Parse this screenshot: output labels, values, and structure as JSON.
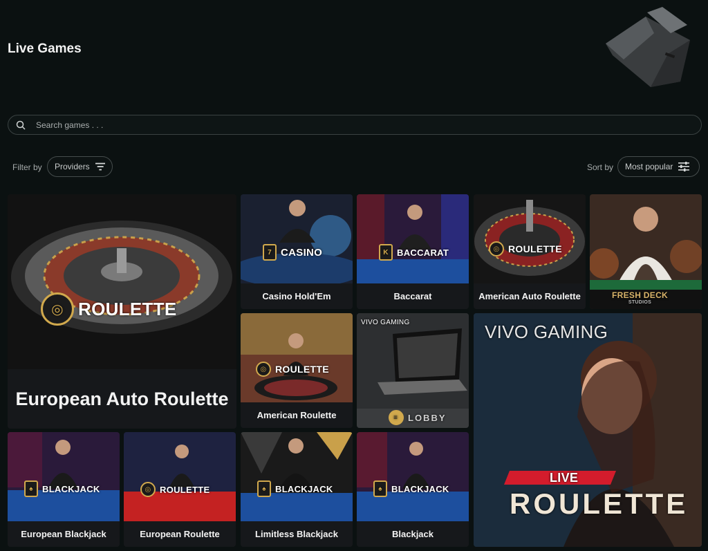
{
  "page": {
    "title": "Live Games"
  },
  "search": {
    "placeholder": "Search games . . ."
  },
  "filter": {
    "label": "Filter by",
    "value": "Providers"
  },
  "sort": {
    "label": "Sort by",
    "value": "Most popular"
  },
  "colors": {
    "background": "#0b1111",
    "card_label_bg": "#16181b",
    "gold_accent": "#d1a94d",
    "table_blue": "#1d4f9e",
    "red_accent": "#d31c2c"
  },
  "games": [
    {
      "title": "European Auto Roulette",
      "badge": "ROULETTE"
    },
    {
      "title": "Casino Hold'Em",
      "badge": "CASINO"
    },
    {
      "title": "Baccarat",
      "badge": "BACCARAT"
    },
    {
      "title": "American Auto Roulette",
      "badge": "ROULETTE"
    },
    {
      "title": "",
      "badge": "FRESH DECK",
      "sub": "STUDIOS"
    },
    {
      "title": "American Roulette",
      "badge": "ROULETTE"
    },
    {
      "title": "",
      "badge": "LOBBY",
      "logo": "VIVO GAMING"
    },
    {
      "title": "",
      "badge": "ROULETTE",
      "sub_badge": "LIVE",
      "logo": "VIVO GAMING"
    },
    {
      "title": "European Blackjack",
      "badge": "BLACKJACK"
    },
    {
      "title": "European Roulette",
      "badge": "ROULETTE"
    },
    {
      "title": "Limitless Blackjack",
      "badge": "BLACKJACK"
    },
    {
      "title": "Blackjack",
      "badge": "BLACKJACK"
    }
  ]
}
